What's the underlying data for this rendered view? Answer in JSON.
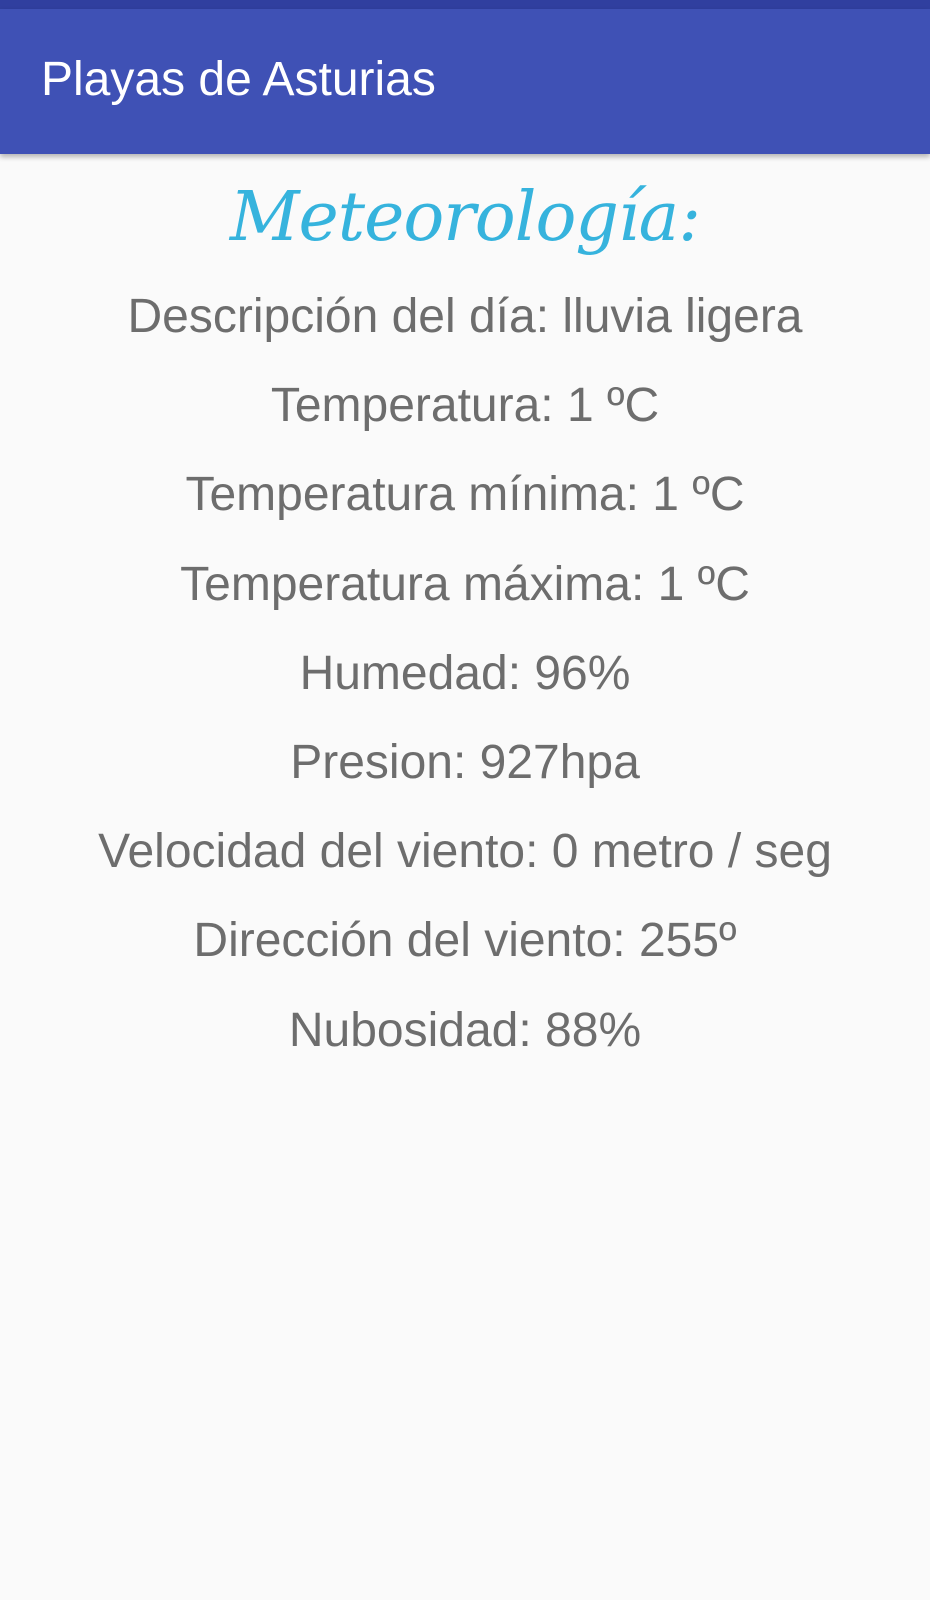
{
  "app_bar": {
    "title": "Playas de Asturias"
  },
  "main": {
    "heading": "Meteorología:",
    "items": [
      "Descripción del día: lluvia ligera",
      "Temperatura: 1 ºC",
      "Temperatura mínima: 1 ºC",
      "Temperatura máxima: 1 ºC",
      "Humedad: 96%",
      "Presion: 927hpa",
      "Velocidad del viento: 0 metro / seg",
      "Dirección del viento: 255º",
      "Nubosidad: 88%"
    ]
  },
  "colors": {
    "status_bar": "#303f9f",
    "app_bar": "#3f51b5",
    "heading": "#36b3dd",
    "body_text": "#6d6d6d",
    "background": "#fafafa"
  }
}
